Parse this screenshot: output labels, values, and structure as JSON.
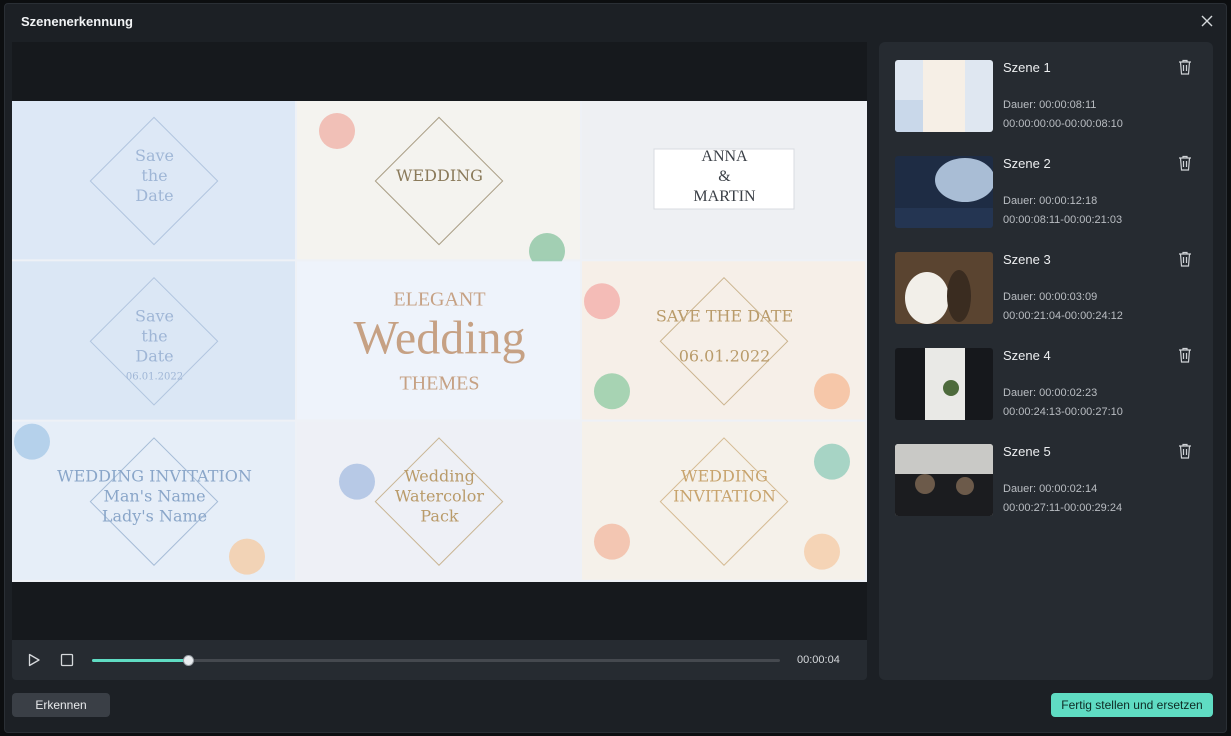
{
  "dialog": {
    "title": "Szenenerkennung"
  },
  "preview": {
    "tiles": [
      {
        "line1": "Save",
        "line2": "the",
        "line3": "Date",
        "caption": "",
        "accent": "#9fb6d6"
      },
      {
        "line1": "",
        "line2": "WEDDING",
        "line3": "",
        "caption": "",
        "accent": "#8a7a5a"
      },
      {
        "line1": "ANNA",
        "line2": "&",
        "line3": "MARTIN",
        "caption": "",
        "accent": "#3a3f46"
      },
      {
        "line1": "Save",
        "line2": "the",
        "line3": "Date",
        "caption": "06.01.2022",
        "accent": "#9fb6d6"
      },
      {
        "line1": "ELEGANT",
        "line2": "Wedding",
        "line3": "THEMES",
        "caption": "",
        "accent": "#c6a184"
      },
      {
        "line1": "SAVE THE DATE",
        "line2": "",
        "line3": "06.01.2022",
        "caption": "",
        "accent": "#b99b6a"
      },
      {
        "line1": "WEDDING INVITATION",
        "line2": "Man's Name",
        "line3": "Lady's Name",
        "caption": "",
        "accent": "#8aa6c9"
      },
      {
        "line1": "Wedding",
        "line2": "Watercolor",
        "line3": "Pack",
        "caption": "",
        "accent": "#b99b6a"
      },
      {
        "line1": "WEDDING",
        "line2": "INVITATION",
        "line3": "",
        "caption": "",
        "accent": "#c8a46e"
      }
    ]
  },
  "player": {
    "current_time": "00:00:04",
    "progress": 0.14,
    "accent": "#5fdcc3"
  },
  "scenes": [
    {
      "name": "Szene 1",
      "duration": "Dauer: 00:00:08:11",
      "range": "00:00:00:00-00:00:08:10",
      "thumb_colors": [
        "#dfe7f1",
        "#f6efe6",
        "#c9d8ea"
      ]
    },
    {
      "name": "Szene 2",
      "duration": "Dauer: 00:00:12:18",
      "range": "00:00:08:11-00:00:21:03",
      "thumb_colors": [
        "#1e2c44",
        "#b8cde6",
        "#243552"
      ]
    },
    {
      "name": "Szene 3",
      "duration": "Dauer: 00:00:03:09",
      "range": "00:00:21:04-00:00:24:12",
      "thumb_colors": [
        "#5a4430",
        "#f2efe9",
        "#3a2c20"
      ]
    },
    {
      "name": "Szene 4",
      "duration": "Dauer: 00:00:02:23",
      "range": "00:00:24:13-00:00:27:10",
      "thumb_colors": [
        "#16181c",
        "#e9e9e6",
        "#4d6a3c"
      ]
    },
    {
      "name": "Szene 5",
      "duration": "Dauer: 00:00:02:14",
      "range": "00:00:27:11-00:00:29:24",
      "thumb_colors": [
        "#c9c9c6",
        "#1b1c1f",
        "#6c5a4a"
      ]
    }
  ],
  "footer": {
    "detect_label": "Erkennen",
    "finish_label": "Fertig stellen und ersetzen"
  }
}
